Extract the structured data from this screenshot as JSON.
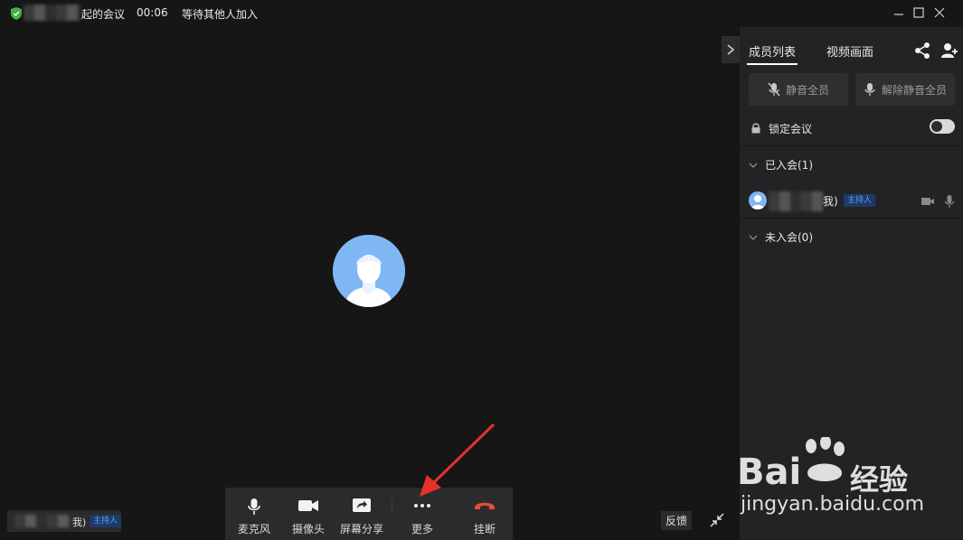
{
  "titlebar": {
    "meeting_title": "起的会议",
    "timer": "00:06",
    "waiting": "等待其他人加入"
  },
  "panel": {
    "tabs": [
      {
        "label": "成员列表",
        "active": true
      },
      {
        "label": "视频画面",
        "active": false
      }
    ],
    "mute_all": "静音全员",
    "unmute_all": "解除静音全员",
    "lock_meeting": "锁定会议",
    "lock_enabled": false,
    "joined_section": "已入会(1)",
    "not_joined_section": "未入会(0)",
    "member": {
      "name_suffix": "我)",
      "role_badge": "主持人"
    }
  },
  "toolbar": {
    "items": [
      {
        "label": "麦克风",
        "icon": "microphone-icon"
      },
      {
        "label": "摄像头",
        "icon": "camera-icon"
      },
      {
        "label": "屏幕分享",
        "icon": "screen-share-icon"
      },
      {
        "label": "更多",
        "icon": "more-icon"
      },
      {
        "label": "挂断",
        "icon": "hangup-icon"
      }
    ]
  },
  "name_tag": {
    "name_suffix": "我)",
    "role_badge": "主持人"
  },
  "feedback": "反馈",
  "watermark": {
    "brand": "Bai",
    "brand_cn": "经验",
    "url": "jingyan.baidu.com"
  },
  "colors": {
    "background": "#161617",
    "panel": "#232325",
    "toolbar": "#2b2b2d",
    "hangup": "#e84c3d",
    "avatar": "#7fb6f4",
    "badge_text": "#5b9dff",
    "arrow": "#e8302a",
    "shield": "#3db34a"
  }
}
